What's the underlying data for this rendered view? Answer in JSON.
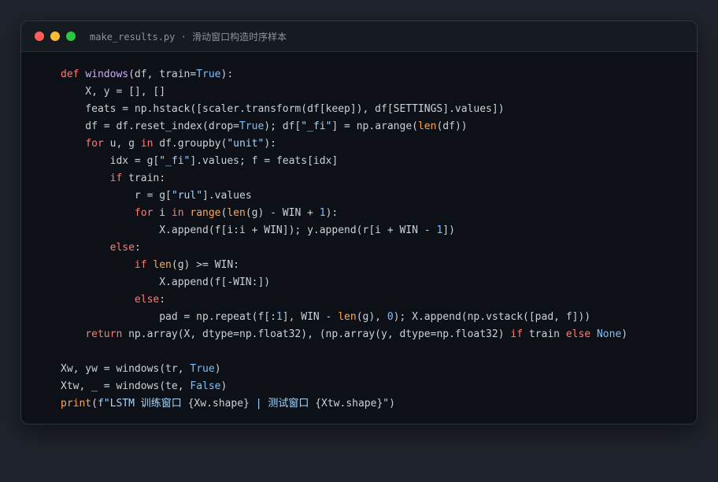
{
  "window": {
    "filename": "make_results.py",
    "separator": " · ",
    "subtitle": "滑动窗口构造时序样本",
    "traffic_lights": [
      {
        "name": "close",
        "color": "#ff5f57"
      },
      {
        "name": "minimize",
        "color": "#febc2e"
      },
      {
        "name": "maximize",
        "color": "#28c840"
      }
    ]
  },
  "code": {
    "language": "python",
    "lines": [
      [
        [
          "kw",
          "def"
        ],
        [
          "tx",
          " "
        ],
        [
          "fn",
          "windows"
        ],
        [
          "tx",
          "(df, train="
        ],
        [
          "cn",
          "True"
        ],
        [
          "tx",
          "):"
        ]
      ],
      [
        [
          "tx",
          "    X, y = [], []"
        ]
      ],
      [
        [
          "tx",
          "    feats = np.hstack([scaler.transform(df[keep]), df[SETTINGS].values])"
        ]
      ],
      [
        [
          "tx",
          "    df = df.reset_index(drop="
        ],
        [
          "cn",
          "True"
        ],
        [
          "tx",
          "); df["
        ],
        [
          "st",
          "\"_fi\""
        ],
        [
          "tx",
          "] = np.arange("
        ],
        [
          "bi",
          "len"
        ],
        [
          "tx",
          "(df))"
        ]
      ],
      [
        [
          "tx",
          "    "
        ],
        [
          "kw",
          "for"
        ],
        [
          "tx",
          " u, g "
        ],
        [
          "kw",
          "in"
        ],
        [
          "tx",
          " df.groupby("
        ],
        [
          "st",
          "\"unit\""
        ],
        [
          "tx",
          "):"
        ]
      ],
      [
        [
          "tx",
          "        idx = g["
        ],
        [
          "st",
          "\"_fi\""
        ],
        [
          "tx",
          "].values; f = feats[idx]"
        ]
      ],
      [
        [
          "tx",
          "        "
        ],
        [
          "kw",
          "if"
        ],
        [
          "tx",
          " train:"
        ]
      ],
      [
        [
          "tx",
          "            r = g["
        ],
        [
          "st",
          "\"rul\""
        ],
        [
          "tx",
          "].values"
        ]
      ],
      [
        [
          "tx",
          "            "
        ],
        [
          "kw",
          "for"
        ],
        [
          "tx",
          " i "
        ],
        [
          "kw",
          "in"
        ],
        [
          "tx",
          " "
        ],
        [
          "bi",
          "range"
        ],
        [
          "tx",
          "("
        ],
        [
          "bi",
          "len"
        ],
        [
          "tx",
          "(g) - WIN + "
        ],
        [
          "nm",
          "1"
        ],
        [
          "tx",
          "):"
        ]
      ],
      [
        [
          "tx",
          "                X.append(f[i:i + WIN]); y.append(r[i + WIN - "
        ],
        [
          "nm",
          "1"
        ],
        [
          "tx",
          "])"
        ]
      ],
      [
        [
          "tx",
          "        "
        ],
        [
          "kw",
          "else"
        ],
        [
          "tx",
          ":"
        ]
      ],
      [
        [
          "tx",
          "            "
        ],
        [
          "kw",
          "if"
        ],
        [
          "tx",
          " "
        ],
        [
          "bi",
          "len"
        ],
        [
          "tx",
          "(g) >= WIN:"
        ]
      ],
      [
        [
          "tx",
          "                X.append(f[-WIN:])"
        ]
      ],
      [
        [
          "tx",
          "            "
        ],
        [
          "kw",
          "else"
        ],
        [
          "tx",
          ":"
        ]
      ],
      [
        [
          "tx",
          "                pad = np.repeat(f[:"
        ],
        [
          "nm",
          "1"
        ],
        [
          "tx",
          "], WIN - "
        ],
        [
          "bi",
          "len"
        ],
        [
          "tx",
          "(g), "
        ],
        [
          "nm",
          "0"
        ],
        [
          "tx",
          "); X.append(np.vstack([pad, f]))"
        ]
      ],
      [
        [
          "tx",
          "    "
        ],
        [
          "kw",
          "return"
        ],
        [
          "tx",
          " np.array(X, dtype=np.float32), (np.array(y, dtype=np.float32) "
        ],
        [
          "kw",
          "if"
        ],
        [
          "tx",
          " train "
        ],
        [
          "kw",
          "else"
        ],
        [
          "tx",
          " "
        ],
        [
          "cn",
          "None"
        ],
        [
          "tx",
          ")"
        ]
      ],
      [],
      [
        [
          "tx",
          "Xw, yw = windows(tr, "
        ],
        [
          "cn",
          "True"
        ],
        [
          "tx",
          ")"
        ]
      ],
      [
        [
          "tx",
          "Xtw, _ = windows(te, "
        ],
        [
          "cn",
          "False"
        ],
        [
          "tx",
          ")"
        ]
      ],
      [
        [
          "bi",
          "print"
        ],
        [
          "tx",
          "("
        ],
        [
          "st",
          "f\"LSTM 训练窗口 "
        ],
        [
          "tx",
          "{Xw.shape}"
        ],
        [
          "st",
          " | 测试窗口 "
        ],
        [
          "tx",
          "{Xtw.shape}"
        ],
        [
          "st",
          "\""
        ],
        [
          "tx",
          ")"
        ]
      ]
    ]
  }
}
